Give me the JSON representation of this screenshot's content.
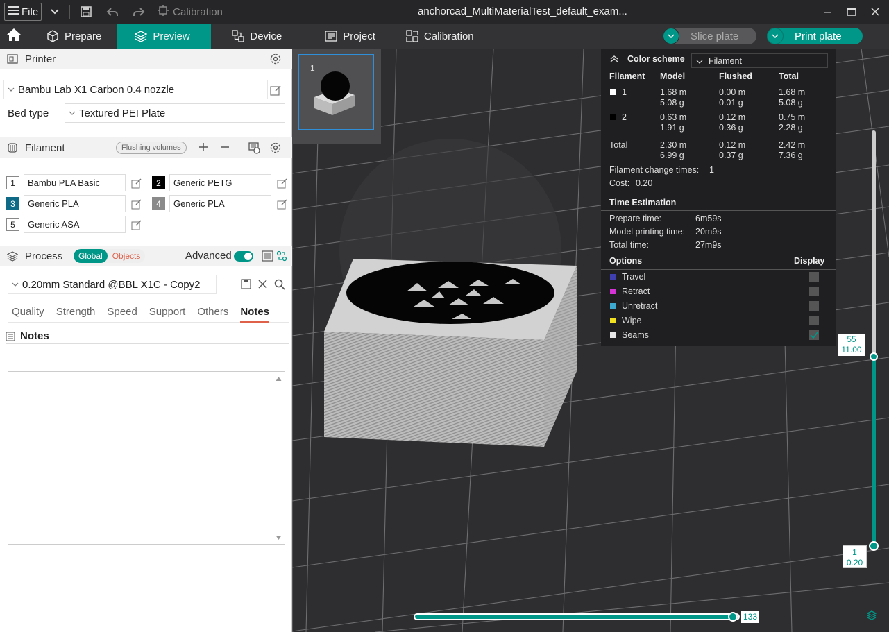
{
  "titlebar": {
    "file_label": "File",
    "calibration_label": "Calibration",
    "window_title": "anchorcad_MultiMaterialTest_default_exam..."
  },
  "nav": {
    "tabs": [
      {
        "label": "Prepare"
      },
      {
        "label": "Preview"
      },
      {
        "label": "Device"
      },
      {
        "label": "Project"
      },
      {
        "label": "Calibration"
      }
    ],
    "slice_label": "Slice plate",
    "print_label": "Print plate"
  },
  "printer": {
    "section_label": "Printer",
    "printer_name": "Bambu Lab X1 Carbon 0.4 nozzle",
    "bed_type_label": "Bed type",
    "bed_type_value": "Textured PEI Plate"
  },
  "filament": {
    "section_label": "Filament",
    "flushing_label": "Flushing volumes",
    "items": [
      {
        "num": "1",
        "name": "Bambu PLA Basic",
        "color": "#ffffff",
        "num_color": "#222222"
      },
      {
        "num": "2",
        "name": "Generic PETG",
        "color": "#000000",
        "num_color": "#ffffff"
      },
      {
        "num": "3",
        "name": "Generic PLA",
        "color": "#0e6a86",
        "num_color": "#ffffff"
      },
      {
        "num": "4",
        "name": "Generic PLA",
        "color": "#8a8a8a",
        "num_color": "#ffffff"
      },
      {
        "num": "5",
        "name": "Generic ASA",
        "color": "#ffffff",
        "num_color": "#222222"
      }
    ]
  },
  "process": {
    "section_label": "Process",
    "global_label": "Global",
    "objects_label": "Objects",
    "advanced_label": "Advanced",
    "preset": "0.20mm Standard @BBL X1C - Copy2",
    "tabs": [
      "Quality",
      "Strength",
      "Speed",
      "Support",
      "Others",
      "Notes"
    ],
    "active_tab": "Notes",
    "notes_heading": "Notes"
  },
  "plate": {
    "index": "1"
  },
  "stats": {
    "color_scheme_label": "Color scheme",
    "color_scheme_value": "Filament",
    "headers": {
      "filament": "Filament",
      "model": "Model",
      "flushed": "Flushed",
      "total": "Total"
    },
    "rows": [
      {
        "id": "1",
        "swatch": "#ffffff",
        "model_m": "1.68 m",
        "model_g": "5.08 g",
        "flushed_m": "0.00 m",
        "flushed_g": "0.01 g",
        "total_m": "1.68 m",
        "total_g": "5.08 g"
      },
      {
        "id": "2",
        "swatch": "#000000",
        "model_m": "0.63 m",
        "model_g": "1.91 g",
        "flushed_m": "0.12 m",
        "flushed_g": "0.36 g",
        "total_m": "0.75 m",
        "total_g": "2.28 g"
      }
    ],
    "total": {
      "label": "Total",
      "model_m": "2.30 m",
      "model_g": "6.99 g",
      "flushed_m": "0.12 m",
      "flushed_g": "0.37 g",
      "total_m": "2.42 m",
      "total_g": "7.36 g"
    },
    "filament_change_label": "Filament change times:",
    "filament_change_value": "1",
    "cost_label": "Cost:",
    "cost_value": "0.20",
    "time_heading": "Time Estimation",
    "prepare_label": "Prepare time:",
    "prepare_value": "6m59s",
    "model_time_label": "Model printing time:",
    "model_time_value": "20m9s",
    "total_time_label": "Total time:",
    "total_time_value": "27m9s",
    "options_heading": "Options",
    "display_heading": "Display",
    "options": [
      {
        "label": "Travel",
        "color": "#3f3fb0",
        "checked": false
      },
      {
        "label": "Retract",
        "color": "#d633d6",
        "checked": false
      },
      {
        "label": "Unretract",
        "color": "#3da8d0",
        "checked": false
      },
      {
        "label": "Wipe",
        "color": "#f0e020",
        "checked": false
      },
      {
        "label": "Seams",
        "color": "#e6e6e6",
        "checked": true
      }
    ]
  },
  "layer_slider": {
    "top_layer": "55",
    "top_height": "11.00",
    "bottom_layer": "1",
    "bottom_height": "0.20"
  },
  "move_slider": {
    "value": "133"
  },
  "colors": {
    "accent": "#009688",
    "objects_orange": "#e0614a"
  }
}
